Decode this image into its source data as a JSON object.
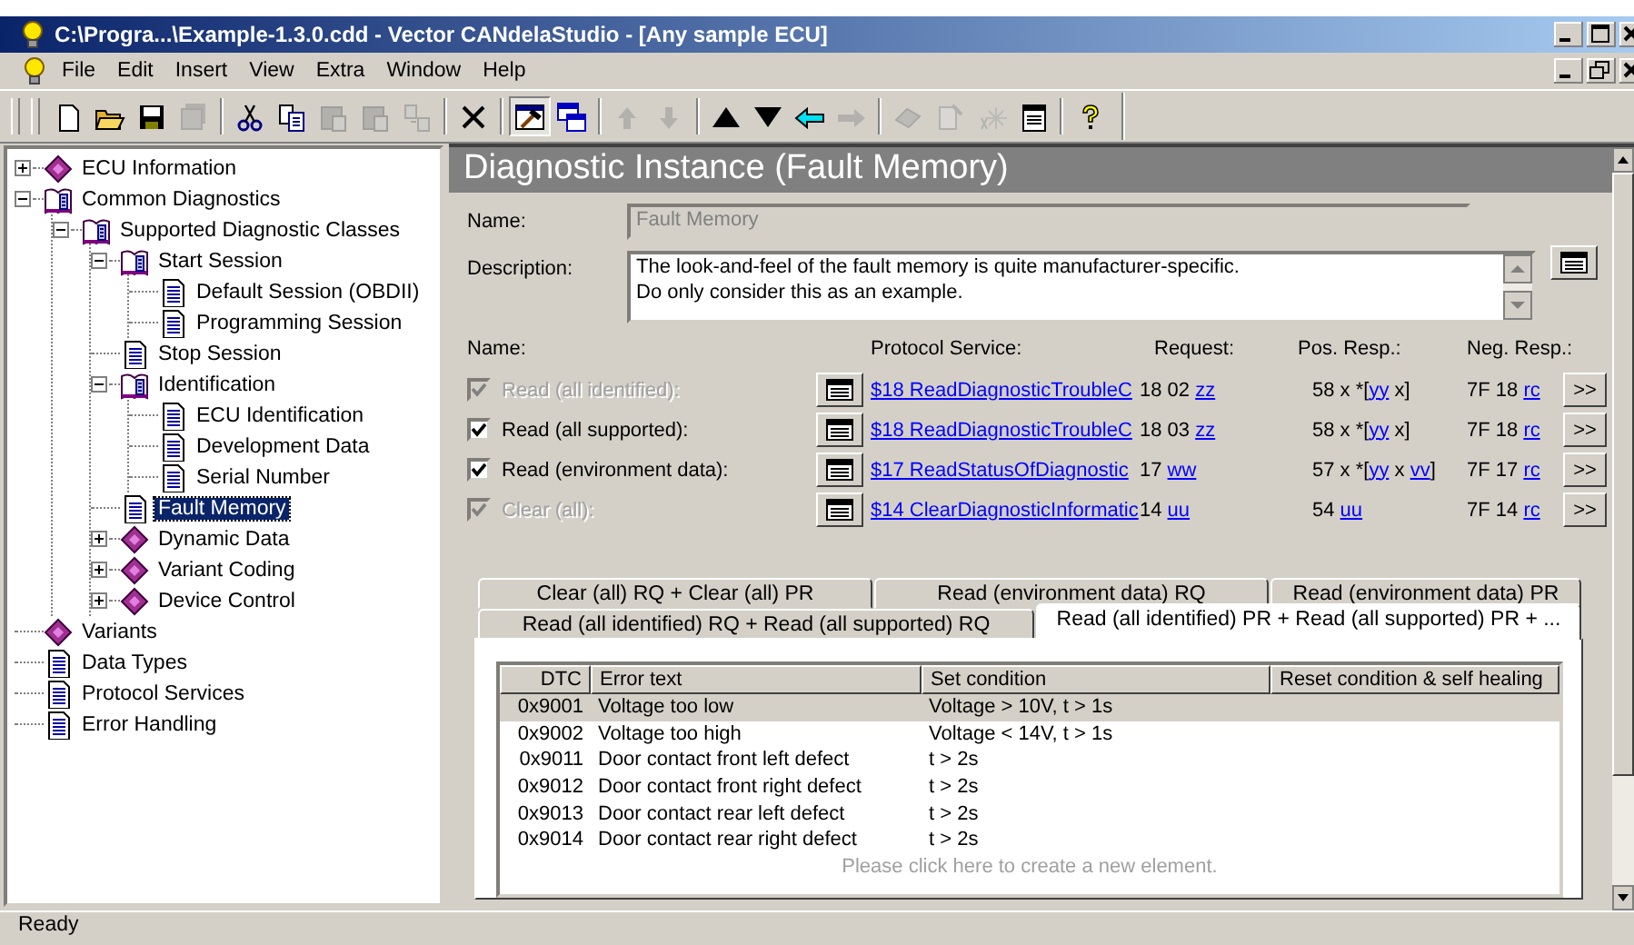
{
  "window": {
    "title": "C:\\Progra...\\Example-1.3.0.cdd - Vector CANdelaStudio - [Any sample ECU]"
  },
  "menu": [
    "File",
    "Edit",
    "Insert",
    "View",
    "Extra",
    "Window",
    "Help"
  ],
  "toolbar": [
    {
      "disabled": false,
      "pressed": false
    },
    {
      "disabled": false,
      "pressed": false
    },
    {
      "disabled": false,
      "pressed": false
    },
    {
      "disabled": true,
      "pressed": false
    },
    {
      "disabled": false,
      "pressed": false
    },
    {
      "disabled": false,
      "pressed": false
    },
    {
      "disabled": true,
      "pressed": false
    },
    {
      "disabled": true,
      "pressed": false
    },
    {
      "disabled": true,
      "pressed": false
    },
    {
      "disabled": false,
      "pressed": false
    },
    {
      "disabled": false,
      "pressed": true
    },
    {
      "disabled": false,
      "pressed": false
    },
    {
      "disabled": true,
      "pressed": false
    },
    {
      "disabled": true,
      "pressed": false
    },
    {
      "disabled": false,
      "pressed": false
    },
    {
      "disabled": false,
      "pressed": false
    },
    {
      "disabled": false,
      "pressed": false
    },
    {
      "disabled": true,
      "pressed": false
    },
    {
      "disabled": true,
      "pressed": false
    },
    {
      "disabled": true,
      "pressed": false
    },
    {
      "disabled": true,
      "pressed": false
    },
    {
      "disabled": false,
      "pressed": false
    },
    {
      "disabled": false,
      "pressed": false
    }
  ],
  "tree": [
    {
      "label": "ECU Information",
      "kind": "module",
      "expanded": false,
      "selected": false
    },
    {
      "label": "Common Diagnostics",
      "kind": "folder",
      "expanded": true,
      "selected": false,
      "children": [
        {
          "label": "Supported Diagnostic Classes",
          "kind": "folder",
          "expanded": true,
          "selected": false,
          "children": [
            {
              "label": "Start Session",
              "kind": "folder",
              "expanded": true,
              "selected": false,
              "children": [
                {
                  "label": "Default Session (OBDII)",
                  "kind": "page",
                  "selected": false
                },
                {
                  "label": "Programming Session",
                  "kind": "page",
                  "selected": false
                }
              ]
            },
            {
              "label": "Stop Session",
              "kind": "page",
              "selected": false
            },
            {
              "label": "Identification",
              "kind": "folder",
              "expanded": true,
              "selected": false,
              "children": [
                {
                  "label": "ECU Identification",
                  "kind": "page",
                  "selected": false
                },
                {
                  "label": "Development Data",
                  "kind": "page",
                  "selected": false
                },
                {
                  "label": "Serial Number",
                  "kind": "page",
                  "selected": false
                }
              ]
            },
            {
              "label": "Fault Memory",
              "kind": "page",
              "selected": true
            },
            {
              "label": "Dynamic Data",
              "kind": "module",
              "expanded": false,
              "selected": false
            },
            {
              "label": "Variant Coding",
              "kind": "module",
              "expanded": false,
              "selected": false
            },
            {
              "label": "Device Control",
              "kind": "module",
              "expanded": false,
              "selected": false
            }
          ]
        }
      ]
    },
    {
      "label": "Variants",
      "kind": "module",
      "selected": false
    },
    {
      "label": "Data Types",
      "kind": "page",
      "selected": false
    },
    {
      "label": "Protocol Services",
      "kind": "page",
      "selected": false
    },
    {
      "label": "Error Handling",
      "kind": "page",
      "selected": false
    }
  ],
  "panel": {
    "title": "Diagnostic Instance (Fault Memory)",
    "name_label": "Name:",
    "name_value": "Fault Memory",
    "description_label": "Description:",
    "description": "The look-and-feel of the fault memory is quite manufacturer-specific.\nDo only consider this as an example.",
    "service_headers": [
      "Name:",
      "Protocol Service:",
      "Request:",
      "Pos. Resp.:",
      "Neg. Resp.:"
    ],
    "services": [
      {
        "name": "Read (all identified):",
        "checked": true,
        "disabled": true,
        "service": "$18 ReadDiagnosticTroubleC",
        "request": [
          {
            "text": "18 02 "
          },
          {
            "text": "zz",
            "link": true
          }
        ],
        "pos_resp": [
          {
            "text": "58 x *["
          },
          {
            "text": "yy",
            "link": true
          },
          {
            "text": " x]"
          }
        ],
        "neg_resp": [
          {
            "text": "7F 18 "
          },
          {
            "text": "rc",
            "link": true
          }
        ],
        "more": ">>"
      },
      {
        "name": "Read (all supported):",
        "checked": true,
        "disabled": false,
        "service": "$18 ReadDiagnosticTroubleC",
        "request": [
          {
            "text": "18 03 "
          },
          {
            "text": "zz",
            "link": true
          }
        ],
        "pos_resp": [
          {
            "text": "58 x *["
          },
          {
            "text": "yy",
            "link": true
          },
          {
            "text": " x]"
          }
        ],
        "neg_resp": [
          {
            "text": "7F 18 "
          },
          {
            "text": "rc",
            "link": true
          }
        ],
        "more": ">>"
      },
      {
        "name": "Read (environment data):",
        "checked": true,
        "disabled": false,
        "service": "$17 ReadStatusOfDiagnostic",
        "request": [
          {
            "text": "17 "
          },
          {
            "text": "ww",
            "link": true
          }
        ],
        "pos_resp": [
          {
            "text": "57 x *["
          },
          {
            "text": "yy",
            "link": true
          },
          {
            "text": " x "
          },
          {
            "text": "vv",
            "link": true
          },
          {
            "text": "]"
          }
        ],
        "neg_resp": [
          {
            "text": "7F 17 "
          },
          {
            "text": "rc",
            "link": true
          }
        ],
        "more": ">>"
      },
      {
        "name": "Clear (all):",
        "checked": true,
        "disabled": true,
        "service": "$14 ClearDiagnosticInformatic",
        "request": [
          {
            "text": "14 "
          },
          {
            "text": "uu",
            "link": true
          }
        ],
        "pos_resp": [
          {
            "text": "54 "
          },
          {
            "text": "uu",
            "link": true
          }
        ],
        "neg_resp": [
          {
            "text": "7F 14 "
          },
          {
            "text": "rc",
            "link": true
          }
        ],
        "more": ">>"
      }
    ]
  },
  "tab_rows": [
    [
      {
        "label": "Clear (all) RQ + Clear (all) PR",
        "selected": false
      },
      {
        "label": "Read (environment data) RQ",
        "selected": false
      },
      {
        "label": "Read (environment data) PR",
        "selected": false
      }
    ],
    [
      {
        "label": "Read (all identified) RQ + Read (all supported) RQ",
        "selected": false
      },
      {
        "label": "Read (all identified) PR + Read (all supported) PR + ...",
        "selected": true
      }
    ]
  ],
  "table": {
    "columns": [
      "DTC",
      "Error text",
      "Set condition",
      "Reset condition & self healing"
    ],
    "rows": [
      {
        "cells": [
          "0x9001",
          "Voltage too low",
          "Voltage > 10V, t > 1s"
        ],
        "selected": true
      },
      {
        "cells": [
          "0x9002",
          "Voltage too high",
          "Voltage < 14V, t > 1s"
        ],
        "selected": false
      },
      {
        "cells": [
          "0x9011",
          "Door contact front left defect",
          "t > 2s"
        ],
        "selected": false
      },
      {
        "cells": [
          "0x9012",
          "Door contact front right defect",
          "t > 2s"
        ],
        "selected": false
      },
      {
        "cells": [
          "0x9013",
          "Door contact rear left defect",
          "t > 2s"
        ],
        "selected": false
      },
      {
        "cells": [
          "0x9014",
          "Door contact rear right defect",
          "t > 2s"
        ],
        "selected": false
      }
    ],
    "footer": "Please click here to create a new element."
  },
  "status_bar": "Ready"
}
